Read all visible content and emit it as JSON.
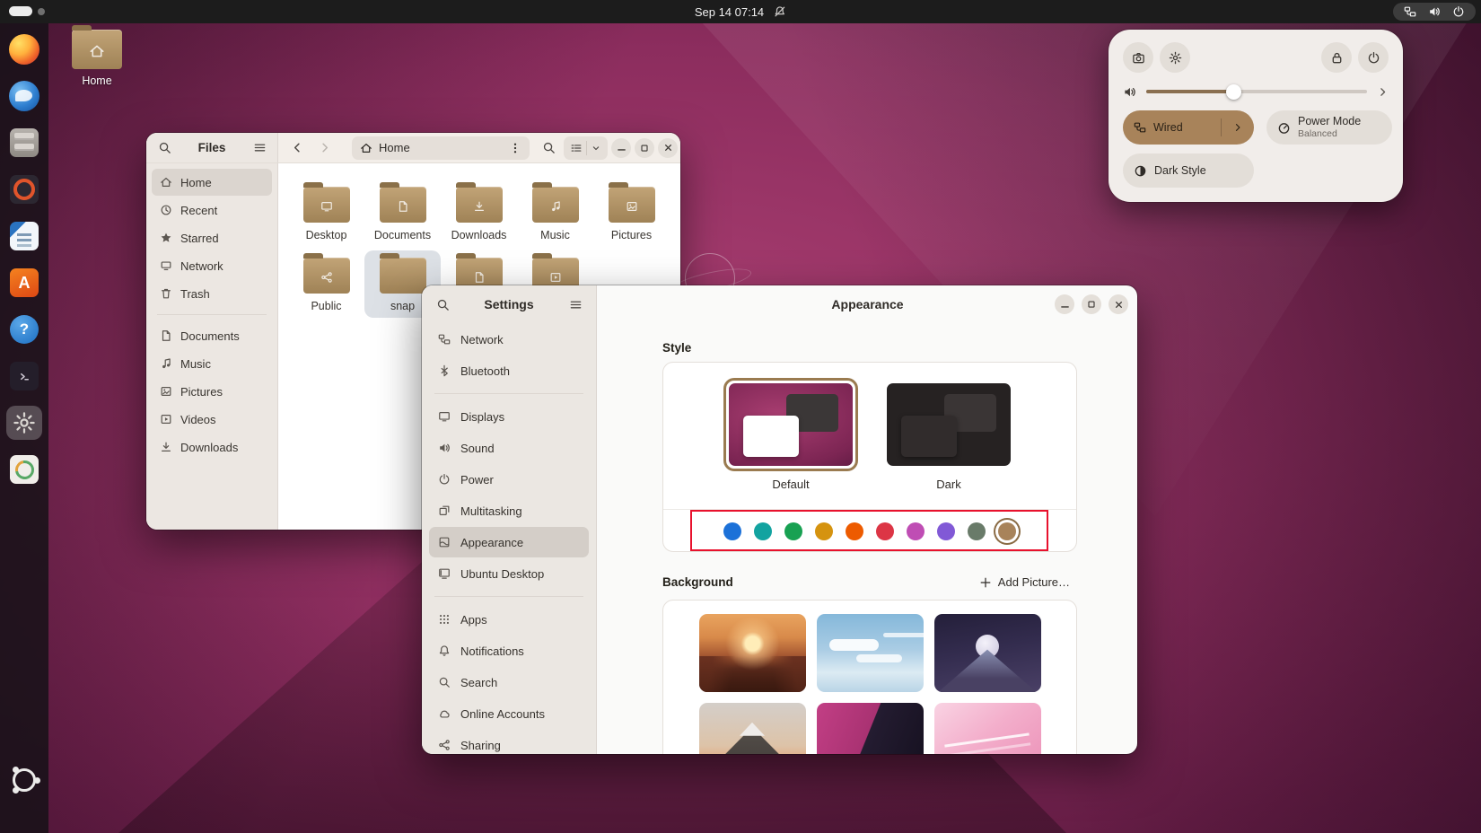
{
  "topbar": {
    "clock": "Sep 14 07:14",
    "status_icons": [
      "network-icon",
      "volume-icon",
      "power-icon"
    ],
    "notification_icon": "bell-slash-icon"
  },
  "desktop": {
    "home_folder_label": "Home"
  },
  "dock": {
    "items": [
      "firefox",
      "thunderbird",
      "files",
      "rhythmbox",
      "libreoffice-writer",
      "app-center",
      "help",
      "terminal",
      "settings",
      "software-updater"
    ],
    "active_item": "settings",
    "logo": "ubuntu-logo"
  },
  "files_window": {
    "title": "Files",
    "breadcrumb": "Home",
    "sidebar": [
      {
        "label": "Home",
        "selected": true
      },
      {
        "label": "Recent",
        "selected": false
      },
      {
        "label": "Starred",
        "selected": false
      },
      {
        "label": "Network",
        "selected": false
      },
      {
        "label": "Trash",
        "selected": false
      },
      {
        "label": "Documents",
        "selected": false
      },
      {
        "label": "Music",
        "selected": false
      },
      {
        "label": "Pictures",
        "selected": false
      },
      {
        "label": "Videos",
        "selected": false
      },
      {
        "label": "Downloads",
        "selected": false
      }
    ],
    "folders_row1": [
      "Desktop",
      "Documents",
      "Downloads",
      "Music",
      "Pictures"
    ],
    "folders_row2": [
      "Public",
      "snap"
    ],
    "selected_folder": "snap"
  },
  "settings_window": {
    "title": "Settings",
    "header_title": "Appearance",
    "sidebar": [
      {
        "label": "Network",
        "selected": false
      },
      {
        "label": "Bluetooth",
        "selected": false
      },
      {
        "label": "Displays",
        "selected": false
      },
      {
        "label": "Sound",
        "selected": false
      },
      {
        "label": "Power",
        "selected": false
      },
      {
        "label": "Multitasking",
        "selected": false
      },
      {
        "label": "Appearance",
        "selected": true
      },
      {
        "label": "Ubuntu Desktop",
        "selected": false
      },
      {
        "label": "Apps",
        "selected": false
      },
      {
        "label": "Notifications",
        "selected": false
      },
      {
        "label": "Search",
        "selected": false
      },
      {
        "label": "Online Accounts",
        "selected": false
      },
      {
        "label": "Sharing",
        "selected": false
      }
    ],
    "style_section": {
      "heading": "Style",
      "options": [
        {
          "label": "Default",
          "selected": true
        },
        {
          "label": "Dark",
          "selected": false
        }
      ],
      "accent_colors": [
        "#1c71d8",
        "#12a3a0",
        "#18a152",
        "#d5930f",
        "#ed5b00",
        "#dc3545",
        "#bf4db4",
        "#8159d6",
        "#697b69",
        "#a8835a"
      ],
      "selected_accent_index": 9
    },
    "background_section": {
      "heading": "Background",
      "add_picture_label": "Add Picture…",
      "wallpapers": [
        "desert-sunset",
        "sky-clouds",
        "night-mountain",
        "fuji-mountain",
        "magenta-split",
        "pink-abstract"
      ]
    }
  },
  "quick_settings": {
    "volume_fill": "40%",
    "buttons": [
      "screenshot",
      "settings",
      "lock",
      "power"
    ],
    "tiles": {
      "wired": {
        "label": "Wired",
        "active": true
      },
      "power_mode": {
        "label": "Power Mode",
        "sublabel": "Balanced"
      },
      "dark_style": {
        "label": "Dark Style",
        "active": false
      }
    }
  },
  "colors": {
    "accent": "#a8835a",
    "annotation_red": "#e8112d",
    "selected_style_border": "#9a7b50"
  }
}
